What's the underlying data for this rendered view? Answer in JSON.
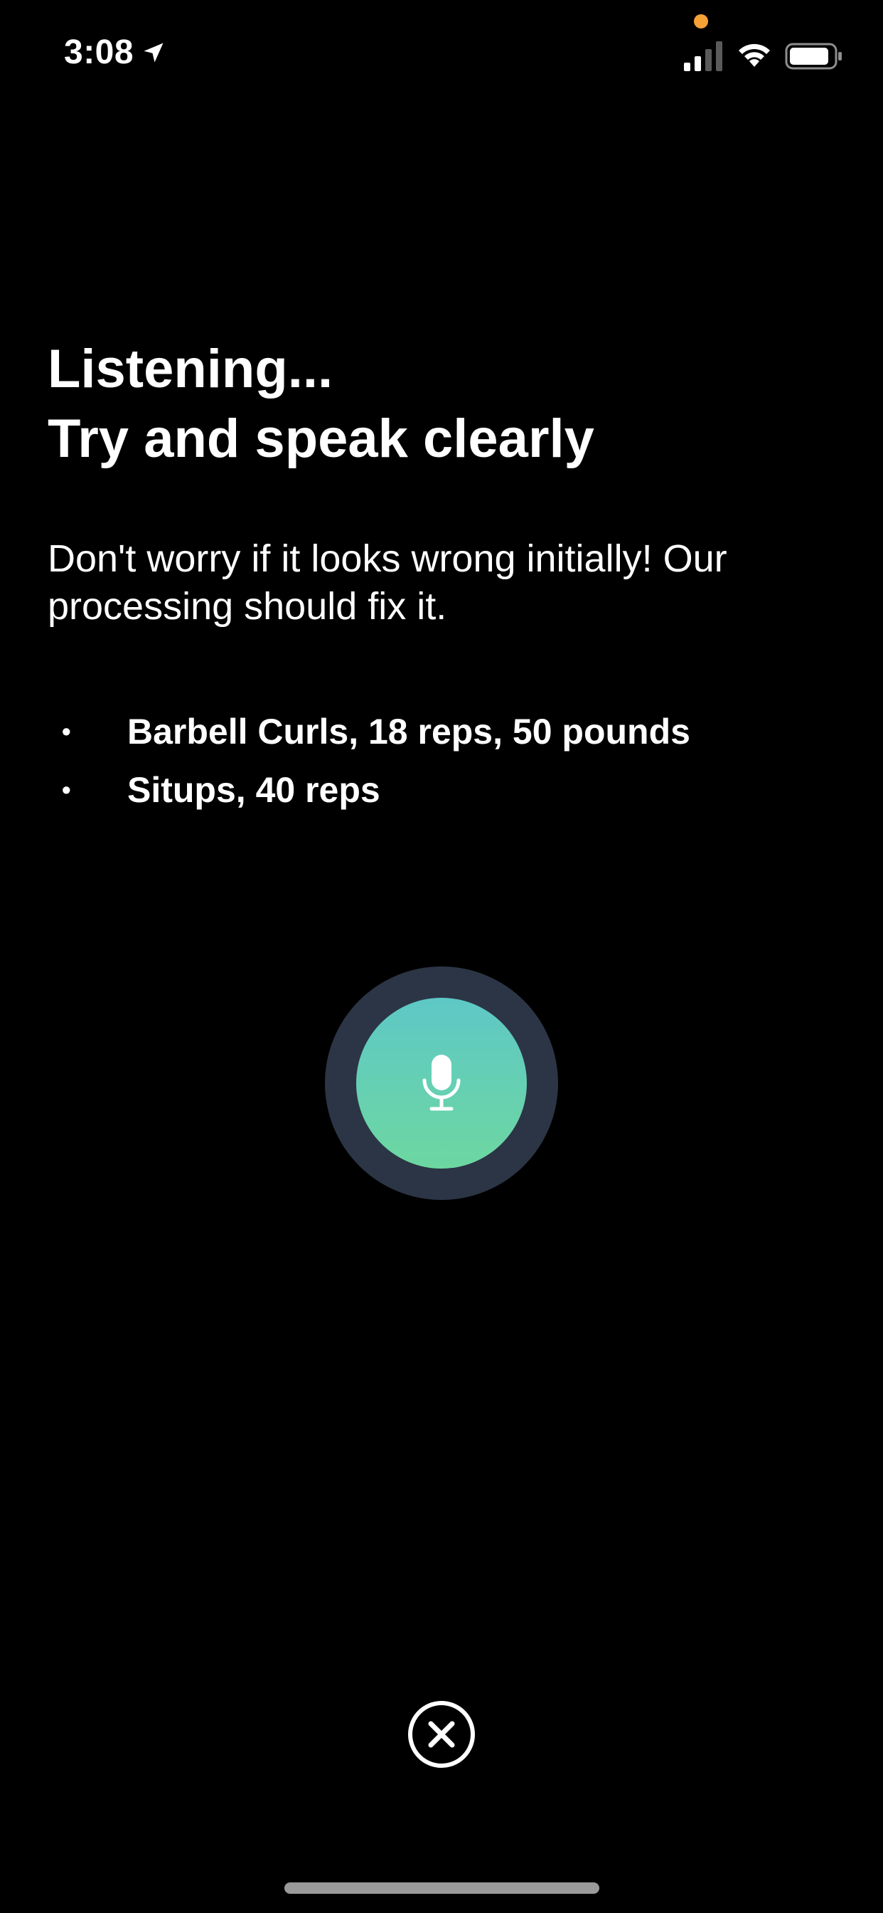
{
  "status_bar": {
    "time": "3:08",
    "icons": [
      "location-arrow-icon",
      "cellular-signal-icon",
      "wifi-icon",
      "battery-icon"
    ],
    "privacy_indicator_color": "#f4a136"
  },
  "heading": {
    "line1": "Listening...",
    "line2": "Try and speak clearly"
  },
  "description": "Don't worry if it looks wrong initially! Our processing should fix it.",
  "examples": [
    "Barbell Curls, 18 reps, 50 pounds",
    "Situps, 40 reps"
  ],
  "bullet": "•",
  "mic": {
    "icon": "microphone-icon",
    "ring_color": "#2b3545",
    "gradient_top": "#5ec8c6",
    "gradient_bottom": "#6dd7a1"
  },
  "close": {
    "icon": "close-circle-icon"
  }
}
